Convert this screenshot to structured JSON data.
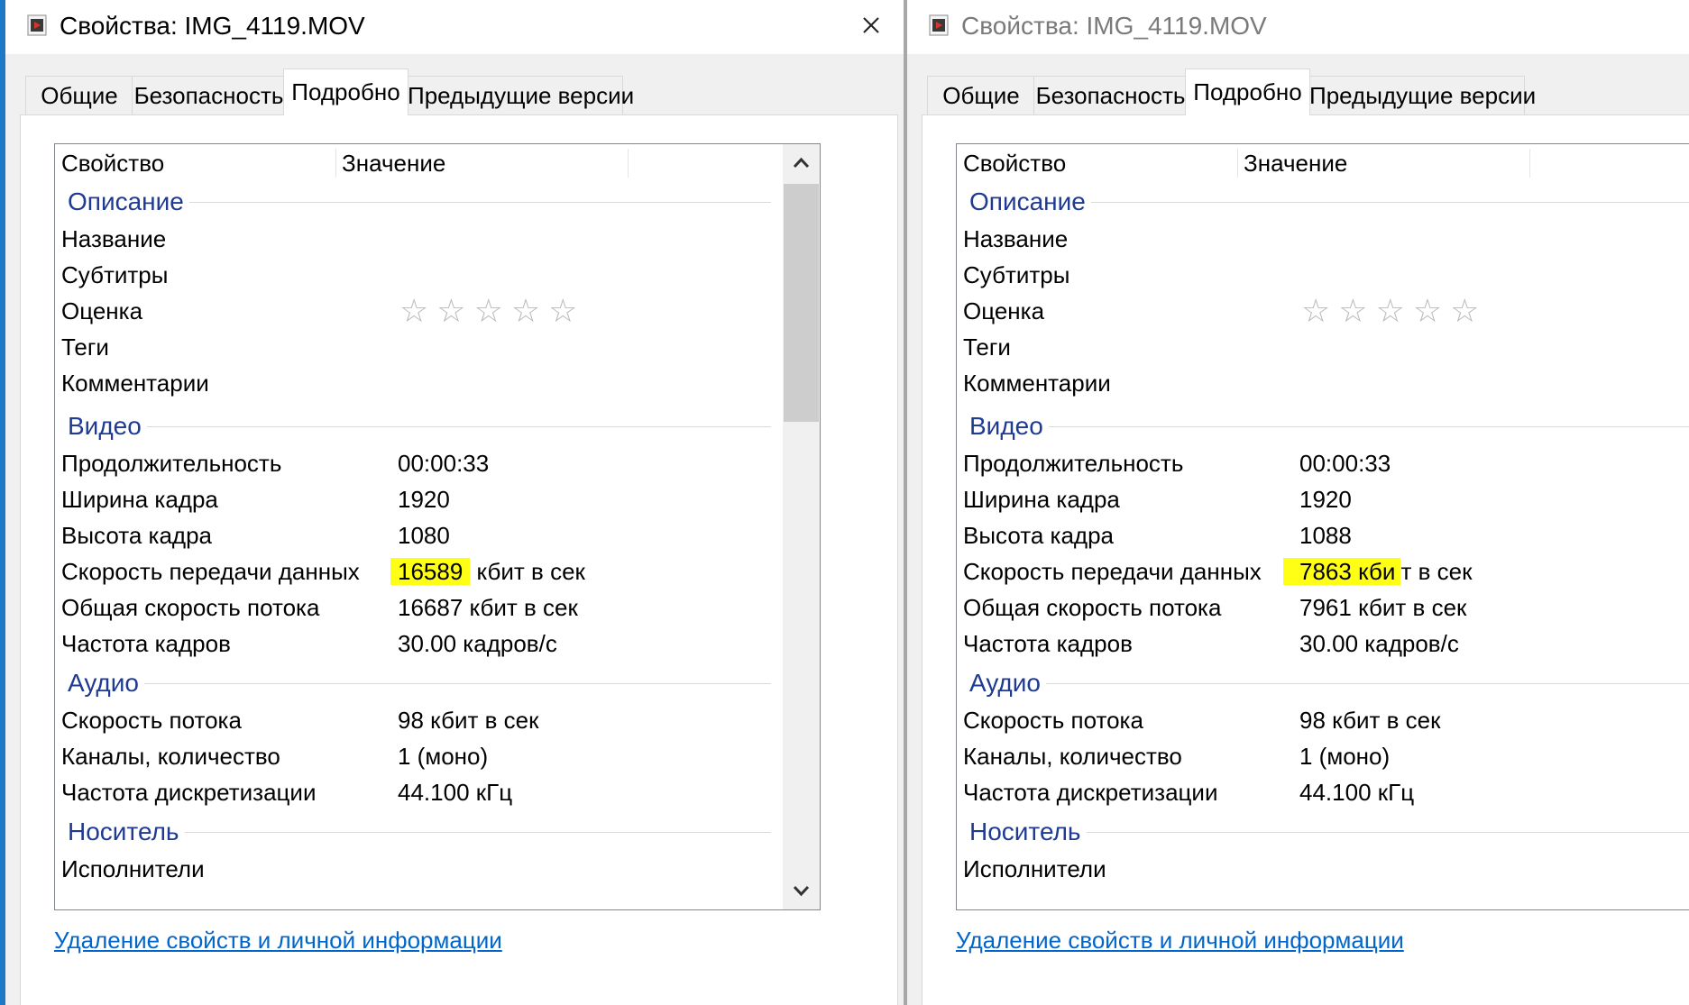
{
  "colors": {
    "accent": "#1f3a93",
    "link": "#0066cc",
    "highlight": "#ffff16",
    "desktop": "#1e78c8"
  },
  "left": {
    "title": "Свойства: IMG_4119.MOV",
    "close_icon": "close-icon",
    "tabs": [
      "Общие",
      "Безопасность",
      "Подробно",
      "Предыдущие версии"
    ],
    "active_tab": "Подробно",
    "columns": {
      "property": "Свойство",
      "value": "Значение"
    },
    "rating_stars": 0,
    "groups": {
      "description": {
        "title": "Описание",
        "rows": [
          {
            "k": "Название",
            "v": ""
          },
          {
            "k": "Субтитры",
            "v": ""
          },
          {
            "k": "Оценка",
            "v": ""
          },
          {
            "k": "Теги",
            "v": ""
          },
          {
            "k": "Комментарии",
            "v": ""
          }
        ]
      },
      "video": {
        "title": "Видео",
        "rows": [
          {
            "k": "Продолжительность",
            "v": "00:00:33"
          },
          {
            "k": "Ширина кадра",
            "v": "1920"
          },
          {
            "k": "Высота кадра",
            "v": "1080"
          },
          {
            "k": "Скорость передачи данных",
            "v_highlight": "16589",
            "v_rest": " кбит в сек"
          },
          {
            "k": "Общая скорость потока",
            "v": "16687 кбит в сек"
          },
          {
            "k": "Частота кадров",
            "v": "30.00 кадров/с"
          }
        ]
      },
      "audio": {
        "title": "Аудио",
        "rows": [
          {
            "k": "Скорость потока",
            "v": "98 кбит в сек"
          },
          {
            "k": "Каналы, количество",
            "v": "1 (моно)"
          },
          {
            "k": "Частота дискретизации",
            "v": "44.100 кГц"
          }
        ]
      },
      "media": {
        "title": "Носитель",
        "rows": [
          {
            "k": "Исполнители",
            "v": ""
          }
        ]
      }
    },
    "link": "Удаление свойств и личной информации"
  },
  "right": {
    "title": "Свойства: IMG_4119.MOV",
    "tabs": [
      "Общие",
      "Безопасность",
      "Подробно",
      "Предыдущие версии"
    ],
    "active_tab": "Подробно",
    "columns": {
      "property": "Свойство",
      "value": "Значение"
    },
    "rating_stars": 0,
    "groups": {
      "description": {
        "title": "Описание",
        "rows": [
          {
            "k": "Название",
            "v": ""
          },
          {
            "k": "Субтитры",
            "v": ""
          },
          {
            "k": "Оценка",
            "v": ""
          },
          {
            "k": "Теги",
            "v": ""
          },
          {
            "k": "Комментарии",
            "v": ""
          }
        ]
      },
      "video": {
        "title": "Видео",
        "rows": [
          {
            "k": "Продолжительность",
            "v": "00:00:33"
          },
          {
            "k": "Ширина кадра",
            "v": "1920"
          },
          {
            "k": "Высота кадра",
            "v": "1088"
          },
          {
            "k": "Скорость передачи данных",
            "v_highlight": "7863 кби",
            "v_rest": "т в сек"
          },
          {
            "k": "Общая скорость потока",
            "v": "7961 кбит в сек"
          },
          {
            "k": "Частота кадров",
            "v": "30.00 кадров/с"
          }
        ]
      },
      "audio": {
        "title": "Аудио",
        "rows": [
          {
            "k": "Скорость потока",
            "v": "98 кбит в сек"
          },
          {
            "k": "Каналы, количество",
            "v": "1 (моно)"
          },
          {
            "k": "Частота дискретизации",
            "v": "44.100 кГц"
          }
        ]
      },
      "media": {
        "title": "Носитель",
        "rows": [
          {
            "k": "Исполнители",
            "v": ""
          }
        ]
      }
    },
    "link": "Удаление свойств и личной информации"
  }
}
